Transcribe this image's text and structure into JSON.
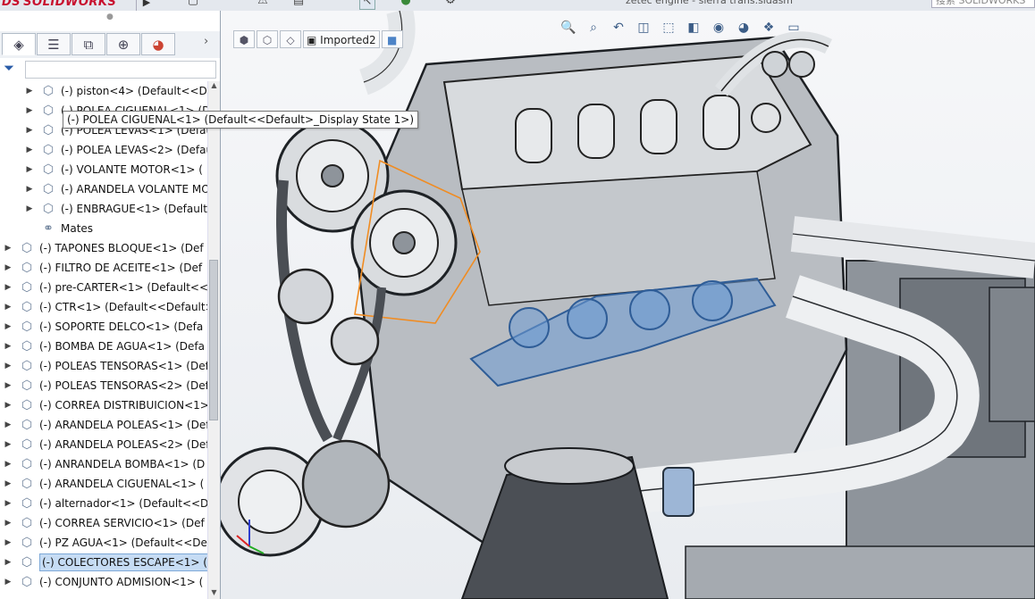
{
  "app": {
    "logo_text": "SOLIDWORKS",
    "logo_prefix": "DS",
    "doc_title": "zetec engine - sierra trans.sldasm",
    "help_search": "搜索 SOLIDWORKS"
  },
  "quick_access": {
    "icons": [
      "new-icon",
      "warning-icon",
      "print-icon",
      "select-pointer-icon",
      "traffic-light-icon",
      "gear-icon"
    ]
  },
  "feature_manager": {
    "tabs": [
      {
        "name": "feature-tree-icon"
      },
      {
        "name": "property-manager-icon"
      },
      {
        "name": "configuration-manager-icon"
      },
      {
        "name": "dimxpert-icon"
      },
      {
        "name": "display-manager-icon"
      }
    ],
    "tooltip": "(-) POLEA CIGUENAL<1> (Default<<Default>_Display State 1>)",
    "tree": [
      {
        "label": "(-) piston<4> (Default<<De",
        "level": 2,
        "selected": false,
        "type": "part"
      },
      {
        "label": "(-) POLEA CIGUENAL<1> (Default<<Default>_Display State 1>)",
        "level": 2,
        "selected": false,
        "type": "part"
      },
      {
        "label": "(-) POLEA LEVAS<1> (Default",
        "level": 2,
        "selected": false,
        "type": "part"
      },
      {
        "label": "(-) POLEA LEVAS<2> (Defau",
        "level": 2,
        "selected": false,
        "type": "part"
      },
      {
        "label": "(-) VOLANTE MOTOR<1> (",
        "level": 2,
        "selected": false,
        "type": "part"
      },
      {
        "label": "(-) ARANDELA VOLANTE MO",
        "level": 2,
        "selected": false,
        "type": "part"
      },
      {
        "label": "(-) ENBRAGUE<1> (Default",
        "level": 2,
        "selected": false,
        "type": "part"
      },
      {
        "label": "Mates",
        "level": 2,
        "selected": false,
        "type": "mates"
      },
      {
        "label": "(-) TAPONES BLOQUE<1> (Def",
        "level": 1,
        "selected": false,
        "type": "part"
      },
      {
        "label": "(-) FILTRO DE ACEITE<1> (Def",
        "level": 1,
        "selected": false,
        "type": "part"
      },
      {
        "label": "(-) pre-CARTER<1> (Default<<",
        "level": 1,
        "selected": false,
        "type": "part"
      },
      {
        "label": "(-) CTR<1> (Default<<Default>",
        "level": 1,
        "selected": false,
        "type": "part"
      },
      {
        "label": "(-) SOPORTE DELCO<1> (Defa",
        "level": 1,
        "selected": false,
        "type": "part"
      },
      {
        "label": "(-) BOMBA DE AGUA<1> (Defa",
        "level": 1,
        "selected": false,
        "type": "part"
      },
      {
        "label": "(-) POLEAS TENSORAS<1> (Def",
        "level": 1,
        "selected": false,
        "type": "part"
      },
      {
        "label": "(-) POLEAS TENSORAS<2> (Def",
        "level": 1,
        "selected": false,
        "type": "part"
      },
      {
        "label": "(-) CORREA DISTRIBUICION<1>",
        "level": 1,
        "selected": false,
        "type": "part"
      },
      {
        "label": "(-) ARANDELA POLEAS<1> (Def",
        "level": 1,
        "selected": false,
        "type": "part"
      },
      {
        "label": "(-) ARANDELA POLEAS<2> (Def",
        "level": 1,
        "selected": false,
        "type": "part"
      },
      {
        "label": "(-) ANRANDELA BOMBA<1> (D",
        "level": 1,
        "selected": false,
        "type": "part"
      },
      {
        "label": "(-) ARANDELA CIGUENAL<1> (",
        "level": 1,
        "selected": false,
        "type": "part"
      },
      {
        "label": "(-) alternador<1> (Default<<De",
        "level": 1,
        "selected": false,
        "type": "part"
      },
      {
        "label": "(-) CORREA SERVICIO<1> (Def",
        "level": 1,
        "selected": false,
        "type": "part"
      },
      {
        "label": "(-) PZ AGUA<1> (Default<<Def",
        "level": 1,
        "selected": false,
        "type": "part"
      },
      {
        "label": "(-) COLECTORES ESCAPE<1> (D",
        "level": 1,
        "selected": true,
        "type": "part"
      },
      {
        "label": "(-) CONJUNTO ADMISION<1> (",
        "level": 1,
        "selected": false,
        "type": "part"
      }
    ]
  },
  "viewport": {
    "breadcrumb": [
      {
        "icon": "assembly-icon",
        "label": ""
      },
      {
        "icon": "subassembly-icon",
        "label": ""
      },
      {
        "icon": "part-icon",
        "label": ""
      },
      {
        "icon": "imported-icon",
        "label": "Imported2"
      },
      {
        "icon": "face-icon",
        "label": ""
      }
    ],
    "heads_up": [
      "zoom-to-fit-icon",
      "zoom-area-icon",
      "previous-view-icon",
      "section-view-icon",
      "view-orientation-icon",
      "display-style-icon",
      "hide-show-icon",
      "edit-appearance-icon",
      "apply-scene-icon",
      "view-settings-icon"
    ],
    "colors": {
      "highlight": "#4d84c7",
      "selection_outline": "#f08c22",
      "background_top": "#f6f7f9",
      "background_bottom": "#e9ecf0"
    }
  }
}
